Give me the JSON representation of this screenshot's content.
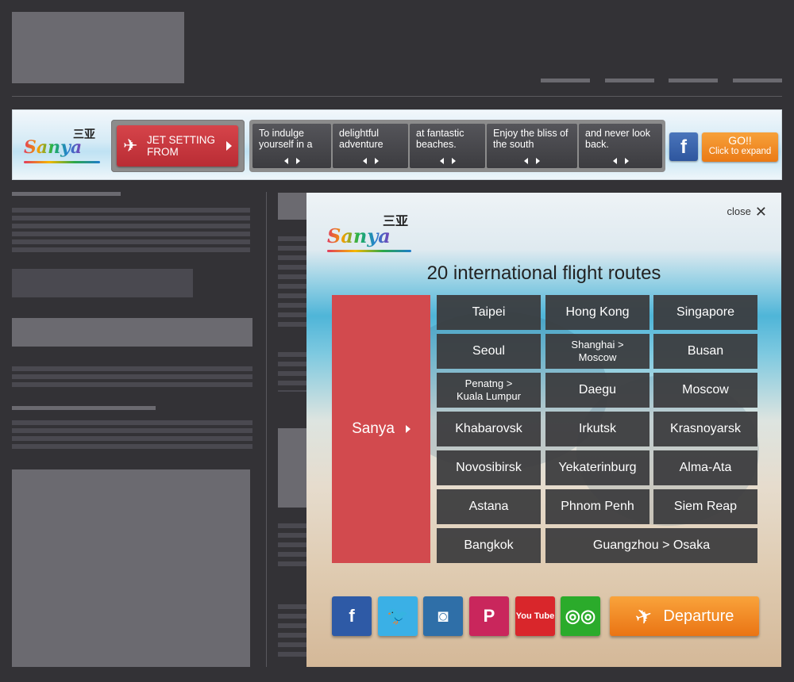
{
  "banner": {
    "logo_text": "Sanya",
    "logo_chinese": "三亚",
    "jet_label": "JET SETTING FROM",
    "steps": [
      {
        "line1": "To indulge",
        "line2": "yourself in a"
      },
      {
        "line1": "delightful",
        "line2": "adventure"
      },
      {
        "line1": "at fantastic",
        "line2": "beaches."
      },
      {
        "line1": "Enjoy the bliss of",
        "line2": "the south"
      },
      {
        "line1": "and never look",
        "line2": "back."
      }
    ],
    "facebook_glyph": "f",
    "go_label": "GO!!",
    "expand_label": "Click to expand"
  },
  "overlay": {
    "logo_text": "Sanya",
    "logo_chinese": "三亚",
    "close_label": "close",
    "close_glyph": "✕",
    "title": "20 international flight routes",
    "origin": "Sanya",
    "routes": [
      {
        "label": "Taipei"
      },
      {
        "label": "Hong Kong"
      },
      {
        "label": "Singapore"
      },
      {
        "label": "Seoul"
      },
      {
        "line1": "Shanghai >",
        "line2": "Moscow"
      },
      {
        "label": "Busan"
      },
      {
        "line1": "Penatng >",
        "line2": "Kuala Lumpur"
      },
      {
        "label": "Daegu"
      },
      {
        "label": "Moscow"
      },
      {
        "label": "Khabarovsk"
      },
      {
        "label": "Irkutsk"
      },
      {
        "label": "Krasnoyarsk"
      },
      {
        "label": "Novosibirsk"
      },
      {
        "label": "Yekaterinburg"
      },
      {
        "label": "Alma-Ata"
      },
      {
        "label": "Astana"
      },
      {
        "label": "Phnom Penh"
      },
      {
        "label": "Siem Reap"
      },
      {
        "label": "Bangkok"
      },
      {
        "label": "Guangzhou > Osaka"
      }
    ],
    "social": [
      {
        "name": "facebook-icon",
        "glyph": "f",
        "color": "#2e5aa6"
      },
      {
        "name": "twitter-icon",
        "glyph": "🐦",
        "color": "#3ab0e6"
      },
      {
        "name": "instagram-icon",
        "glyph": "◙",
        "color": "#2f6fa8"
      },
      {
        "name": "pinterest-icon",
        "glyph": "P",
        "color": "#c9265c"
      },
      {
        "name": "youtube-icon",
        "glyph": "You Tube",
        "color": "#d9262b"
      },
      {
        "name": "tripadvisor-icon",
        "glyph": "◎◎",
        "color": "#2bab2b"
      }
    ],
    "departure_label": "Departure"
  },
  "colors": {
    "background": "#333236",
    "sanya_red": "#d24a4e",
    "orange": "#ef8a22",
    "route_cell": "#3a3a3c"
  }
}
